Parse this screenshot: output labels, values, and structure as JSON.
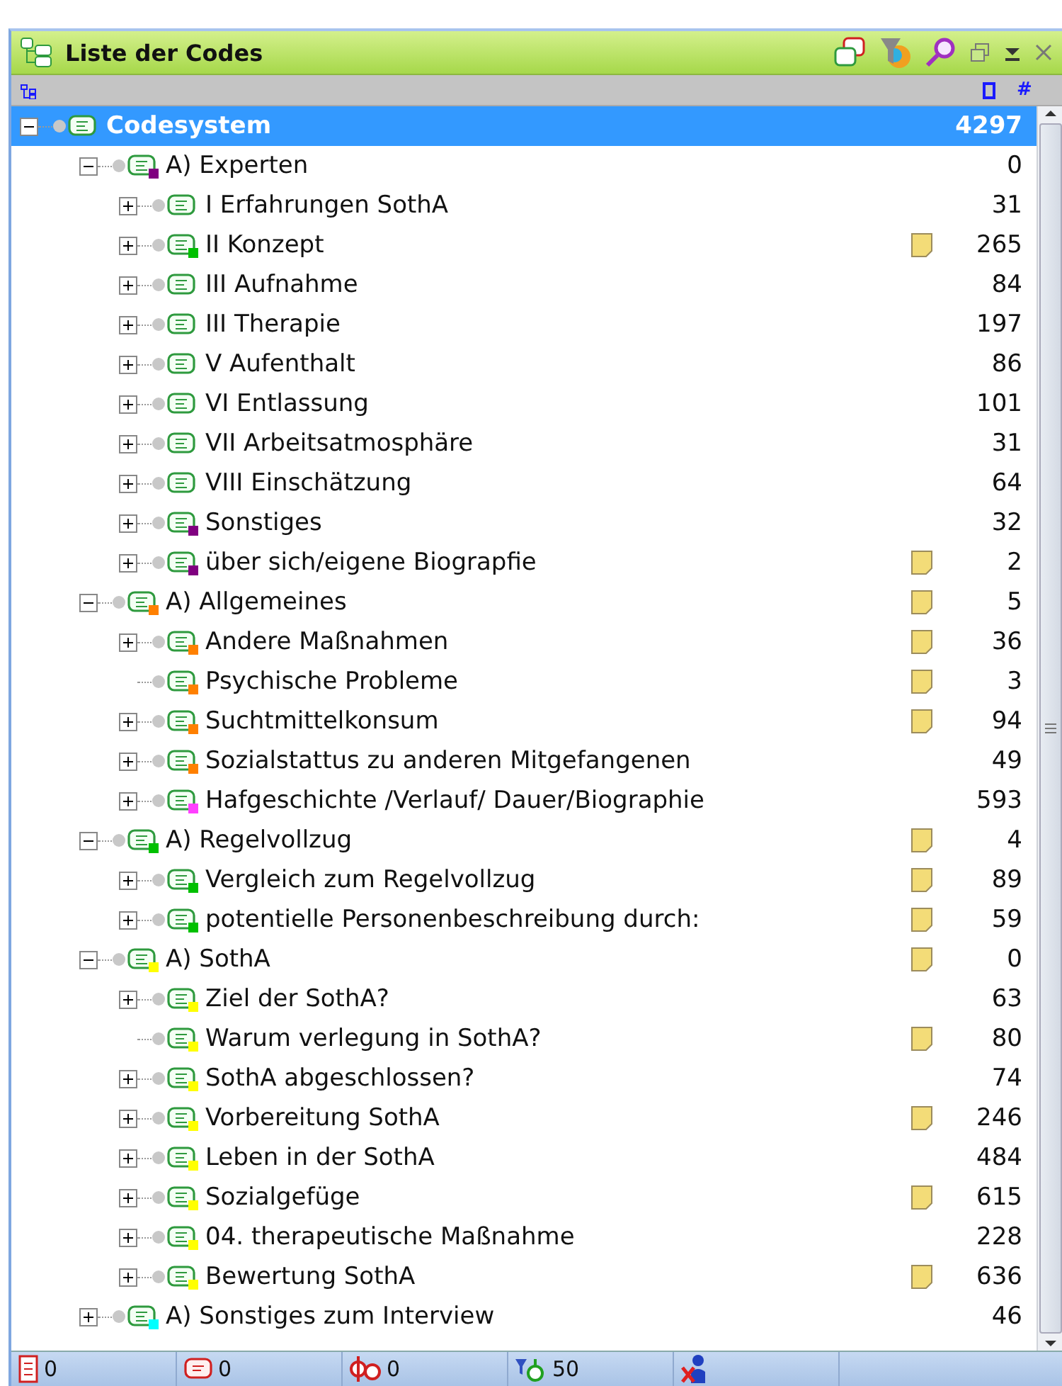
{
  "panel": {
    "title": "Liste der Codes"
  },
  "columns": {
    "count_header": "#"
  },
  "tree": {
    "label": "Codesystem",
    "count": "4297",
    "selected": true,
    "expanded": true,
    "children": [
      {
        "label": "A) Experten",
        "count": "0",
        "color": "#800080",
        "memo": false,
        "expandable": true,
        "expanded": true,
        "children": [
          {
            "label": "I Erfahrungen SothA",
            "count": "31",
            "memo": false,
            "expandable": true
          },
          {
            "label": "II Konzept",
            "count": "265",
            "color": "#00c000",
            "memo": true,
            "expandable": true
          },
          {
            "label": "III Aufnahme",
            "count": "84",
            "memo": false,
            "expandable": true
          },
          {
            "label": "III Therapie",
            "count": "197",
            "memo": false,
            "expandable": true
          },
          {
            "label": "V Aufenthalt",
            "count": "86",
            "memo": false,
            "expandable": true
          },
          {
            "label": "VI Entlassung",
            "count": "101",
            "memo": false,
            "expandable": true
          },
          {
            "label": "VII Arbeitsatmosphäre",
            "count": "31",
            "memo": false,
            "expandable": true
          },
          {
            "label": "VIII Einschätzung",
            "count": "64",
            "memo": false,
            "expandable": true
          },
          {
            "label": "Sonstiges",
            "count": "32",
            "color": "#800080",
            "memo": false,
            "expandable": true
          },
          {
            "label": "über sich/eigene Biograpfie",
            "count": "2",
            "color": "#800080",
            "memo": true,
            "expandable": true
          }
        ]
      },
      {
        "label": "A) Allgemeines",
        "count": "5",
        "color": "#ff8000",
        "memo": true,
        "expandable": true,
        "expanded": true,
        "children": [
          {
            "label": "Andere Maßnahmen",
            "count": "36",
            "color": "#ff8000",
            "memo": true,
            "expandable": true
          },
          {
            "label": "Psychische Probleme",
            "count": "3",
            "color": "#ff8000",
            "memo": true,
            "expandable": false
          },
          {
            "label": "Suchtmittelkonsum",
            "count": "94",
            "color": "#ff8000",
            "memo": true,
            "expandable": true
          },
          {
            "label": "Sozialstattus zu anderen Mitgefangenen",
            "count": "49",
            "color": "#ff8000",
            "memo": false,
            "expandable": true
          },
          {
            "label": "Hafgeschichte /Verlauf/ Dauer/Biographie",
            "count": "593",
            "color": "#ff40ff",
            "memo": false,
            "expandable": true
          }
        ]
      },
      {
        "label": "A) Regelvollzug",
        "count": "4",
        "color": "#00c000",
        "memo": true,
        "expandable": true,
        "expanded": true,
        "children": [
          {
            "label": "Vergleich zum Regelvollzug",
            "count": "89",
            "color": "#00c000",
            "memo": true,
            "expandable": true
          },
          {
            "label": "potentielle Personenbeschreibung durch:",
            "count": "59",
            "color": "#00c000",
            "memo": true,
            "expandable": true
          }
        ]
      },
      {
        "label": "A) SothA",
        "count": "0",
        "color": "#ffff00",
        "memo": true,
        "expandable": true,
        "expanded": true,
        "children": [
          {
            "label": "Ziel der SothA?",
            "count": "63",
            "color": "#ffff00",
            "memo": false,
            "expandable": true
          },
          {
            "label": "Warum verlegung in SothA?",
            "count": "80",
            "color": "#ffff00",
            "memo": true,
            "expandable": false
          },
          {
            "label": "SothA abgeschlossen?",
            "count": "74",
            "color": "#ffff00",
            "memo": false,
            "expandable": true
          },
          {
            "label": "Vorbereitung SothA",
            "count": "246",
            "color": "#ffff00",
            "memo": true,
            "expandable": true
          },
          {
            "label": "Leben in der SothA",
            "count": "484",
            "color": "#ffff00",
            "memo": false,
            "expandable": true
          },
          {
            "label": "Sozialgefüge",
            "count": "615",
            "color": "#ffff00",
            "memo": true,
            "expandable": true
          },
          {
            "label": "04. therapeutische Maßnahme",
            "count": "228",
            "color": "#ffff00",
            "memo": false,
            "expandable": true
          },
          {
            "label": "Bewertung SothA",
            "count": "636",
            "color": "#ffff00",
            "memo": true,
            "expandable": true
          }
        ]
      },
      {
        "label": "A) Sonstiges zum Interview",
        "count": "46",
        "color": "#00ffff",
        "memo": false,
        "expandable": true,
        "expanded": false
      }
    ]
  },
  "status_bar": [
    {
      "kind": "documents",
      "count": "0"
    },
    {
      "kind": "codes",
      "count": "0"
    },
    {
      "kind": "links",
      "count": "0"
    },
    {
      "kind": "filter",
      "count": "50"
    },
    {
      "kind": "user"
    }
  ]
}
